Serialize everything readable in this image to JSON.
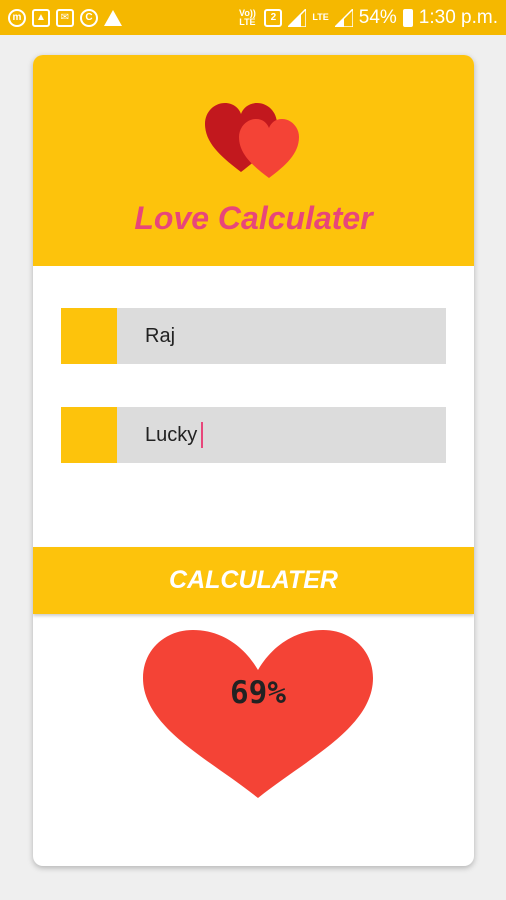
{
  "status_bar": {
    "notif_icons": [
      "messenger-icon",
      "gallery-icon",
      "mail-icon",
      "refresh-icon",
      "warning-icon"
    ],
    "volte": "Vo)) LTE",
    "sim": "2",
    "lte": "LTE",
    "battery": "54%",
    "time": "1:30 p.m."
  },
  "app": {
    "title": "Love Calculater",
    "logo_icon": "two-hearts-icon"
  },
  "form": {
    "name1_value": "Raj",
    "name2_value": "Lucky"
  },
  "button": {
    "label": "CALCULATER"
  },
  "result": {
    "percent": "69%",
    "icon": "heart-icon"
  },
  "colors": {
    "accent": "#fdc30c",
    "status_bar": "#f5b800",
    "title": "#e8467a",
    "heart": "#f44336",
    "field": "#dcdcdc"
  }
}
